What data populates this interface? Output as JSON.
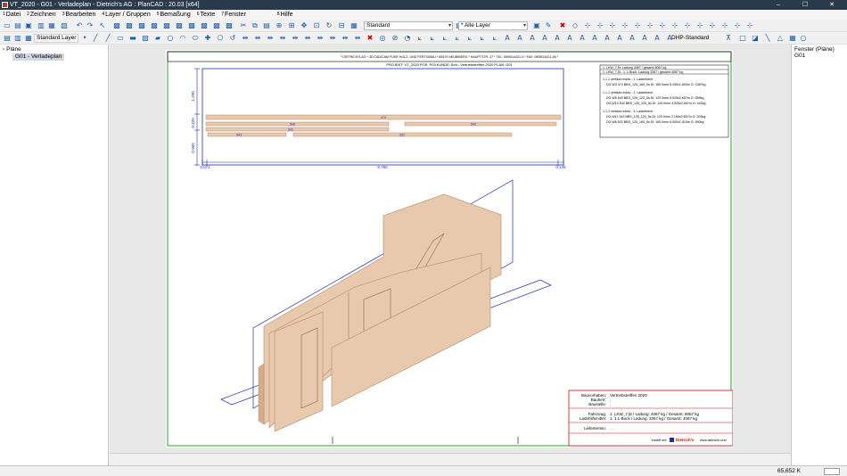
{
  "window": {
    "title": "VT_2020 - G01 - Verladeplan - Dietrich's AG : PlanCAD : 20.03 [x64]",
    "minimize": "–",
    "maximize": "☐",
    "close": "✕"
  },
  "menu": [
    {
      "num": "1",
      "label": "Datei"
    },
    {
      "num": "2",
      "label": "Zeichnen"
    },
    {
      "num": "3",
      "label": "Bearbeiten"
    },
    {
      "num": "4",
      "label": "Layer / Gruppen"
    },
    {
      "num": "5",
      "label": "Bemaßung"
    },
    {
      "num": "6",
      "label": "Texte"
    },
    {
      "num": "7",
      "label": "Fenster"
    },
    {
      "num": "8",
      "label": "Hilfe"
    }
  ],
  "toolbar": {
    "layer_combo": "Standard",
    "all_layers_combo": "* Alle Layer",
    "standard_layer": "Standard Layer",
    "dimension_style": "DHP-Standard"
  },
  "tree": {
    "root": "Pläne",
    "item": "G01 - Verladeplan"
  },
  "right_panel": {
    "title": "Fenster (Pläne)",
    "item": "G01"
  },
  "drawing": {
    "header_line1": "* DIETRICH'S AG * 3D CAD/CAM FUER HOLZ- UND FERTIGBAU * 85579 NEUBIBERG * HAUPTSTR. 37 * TEL: 089/614421-0 * FAX: 089/614421-46 *",
    "header_line2": "PROJEKT: VT_2020     POS: P03     KUNDE:     Bvh.: Vertriebstreffen 2020     PLAN: G01",
    "dim_vertical": [
      "1.290",
      "0.320",
      "0.960"
    ],
    "dim_horizontal": [
      "0.071",
      "9.780",
      "0.149"
    ],
    "panel_labels": [
      "474",
      "540",
      "542",
      "541",
      "543",
      "532"
    ],
    "info_lines": [
      "1. LKW_7,5t: Ladung 4067 / gesamt 8067 kg",
      "1. LKW_7,5t - 1. L-Bock: Ladung 3367 / gesamt 4067 kg",
      "1.1.1 vertikal rechts - 1. Ladeebene",
      "DG.W3   474   BBS_125_160_5s   Di: 160.0mm   5.255x1.803m   G: 1567kg",
      "1.1.1 vertikal rechts - 2. Ladeebene",
      "DG.W8   540   BBS_125_120_5s   Di: 120.0mm   5.025x2.657m   G: 559kg",
      "DG.W10  542   BBS_125_120_5s   Di: 120.0mm   3.525x2.657m   G: 442kg",
      "1.1.1 vertikal rechts - 3. Ladeebene",
      "DG.W11  543   BBS_125_120_5s   Di: 120.0mm   2.165x2.657m   G: 209kg",
      "DG.W6   532   BBS_125_160_5s   Di: 160.0mm   6.000x1.510m   G: 590kg"
    ],
    "title_block": {
      "bauvorhaben_label": "Bauvorhaben:",
      "bauvorhaben_value": "Vertriebstreffen 2020",
      "bauherr_label": "Bauherr:",
      "bauherr_value": ",",
      "baustelle_label": "Baustelle:",
      "baustelle_value": ",",
      "fahrzeug_label": "Fahrzeug:",
      "fahrzeug_value": "1. LKW_7,5t / Ladung: 4067 kg / Gesamt: 8067 kg",
      "ladehilfsmittel_label": "Ladehilfsmittel:",
      "ladehilfsmittel_value": "1. 1.L-Bock / Ladung: 3367 kg / Gesamt: 4067 kg",
      "liefertermin_label": "Liefertermin:",
      "liefertermin_value": ". . .",
      "footer_left": "erstellt mit:",
      "footer_brand": "Dietrich's",
      "footer_url": "www.dietrichs.com"
    }
  },
  "status": {
    "zoom": "65,652 K"
  },
  "colors": {
    "titlebar": "#2b3a4a",
    "panel_fill": "#e9c9ad",
    "panel_stroke": "#b18a6a",
    "dim_blue": "#1b2fb0",
    "border_green": "#1fa81f",
    "border_red": "#cc1111"
  }
}
